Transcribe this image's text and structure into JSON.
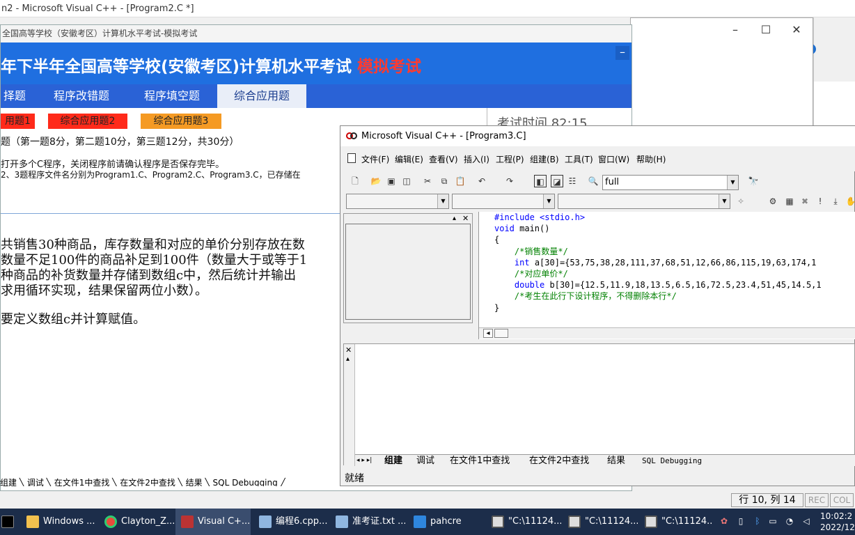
{
  "bg_window": {
    "title": "n2 - Microsoft Visual C++ - [Program2.C *]",
    "help_icon": "?"
  },
  "exam": {
    "title": "全国高等学校（安徽考区）计算机水平考试-模拟考试",
    "banner_main": "年下半年全国高等学校(安徽考区)计算机水平考试",
    "banner_badge": "模拟考试",
    "min_label": "–",
    "tabs": [
      "择题",
      "程序改错题",
      "程序填空题",
      "综合应用题"
    ],
    "question_buttons": [
      "用题1",
      "综合应用题2",
      "综合应用题3"
    ],
    "timer_label": "考试时间",
    "timer_value": "82:15",
    "section_info": "题（第一题8分，第二题10分，第三题12分，共30分）",
    "notice_1": "打开多个C程序，关闭程序前请确认程序是否保存完毕。",
    "notice_2": "2、3题程序文件名分别为Program1.C、Program2.C、Program3.C，已存储在",
    "body_lines": [
      "共销售30种商品，库存数量和对应的单价分别存放在数",
      "数量不足100件的商品补足到100件（数量大于或等于1",
      "种商品的补货数量并存储到数组c中，然后统计并输出",
      "求用循环实现，结果保留两位小数）。",
      "要定义数组c并计算赋值。"
    ]
  },
  "vc": {
    "title": "Microsoft Visual C++ - [Program3.C]",
    "menu": [
      "文件(F)",
      "编辑(E)",
      "查看(V)",
      "插入(I)",
      "工程(P)",
      "组建(B)",
      "工具(T)",
      "窗口(W)",
      "帮助(H)"
    ],
    "config_combo": "full",
    "code": {
      "line1": "#include <stdio.h>",
      "line2_kw": "void",
      "line2_rest": " main()",
      "line3": "{",
      "line4": "    /*销售数量*/",
      "line5_kw": "int",
      "line5_rest": " a[30]={53,75,38,28,111,37,68,51,12,66,86,115,19,63,174,1",
      "line6": "    /*对应单价*/",
      "line7_kw": "double",
      "line7_rest": " b[30]={12.5,11.9,18,13.5,6.5,16,72.5,23.4,51,45,14.5,1",
      "line8": "    /*考生在此行下设计程序，不得删除本行*/",
      "line9": "",
      "line10": "}"
    },
    "output_tabs": [
      "组建",
      "调试",
      "在文件1中查找",
      "在文件2中查找",
      "结果",
      "SQL Debugging"
    ],
    "status": "就绪"
  },
  "under_tabs": "组建 ╲ 调试 ╲ 在文件1中查找 ╲ 在文件2中查找 ╲ 结果 ╲ SQL Debugging ╱",
  "statusbar": {
    "position": "行 10, 列 14",
    "rec": "REC",
    "col": "COL"
  },
  "taskbar": {
    "items": [
      "Windows ...",
      "Clayton_Z...",
      "Visual C+...",
      "编程6.cpp...",
      "准考证.txt ...",
      "pahcre",
      "\"C:\\11124...",
      "\"C:\\11124...",
      "\"C:\\11124..."
    ],
    "time": "10:02:2",
    "date": "2022/12/"
  },
  "colors": {
    "banner_blue": "#1f6fe0",
    "badge_red": "#ff3b2f",
    "qbtn_red": "#ff2a1a",
    "qbtn_orange": "#f59a23",
    "taskbar": "#1c2d4a"
  }
}
